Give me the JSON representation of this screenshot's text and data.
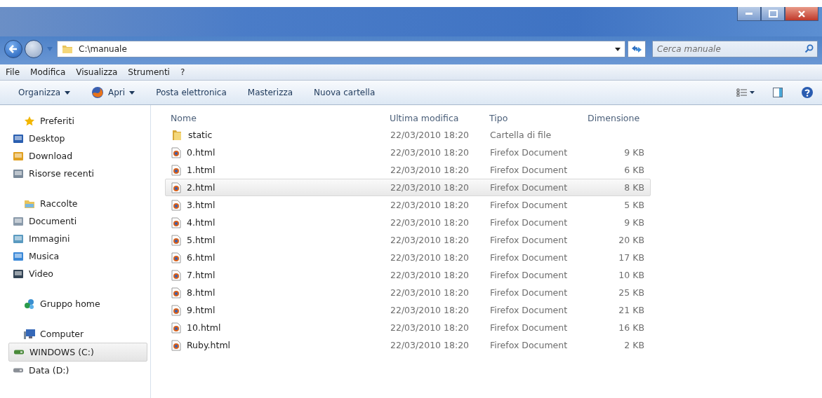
{
  "address": {
    "path": "C:\\manuale"
  },
  "search": {
    "placeholder": "Cerca manuale"
  },
  "menu": [
    "File",
    "Modifica",
    "Visualizza",
    "Strumenti",
    "?"
  ],
  "toolbar": [
    {
      "label": "Organizza",
      "dropdown": true
    },
    {
      "label": "Apri",
      "dropdown": true
    },
    {
      "label": "Posta elettronica",
      "dropdown": false
    },
    {
      "label": "Masterizza",
      "dropdown": false
    },
    {
      "label": "Nuova cartella",
      "dropdown": false
    }
  ],
  "sidebar": {
    "groups": [
      {
        "label": "Preferiti",
        "children": [
          {
            "label": "Desktop",
            "selected": false
          },
          {
            "label": "Download",
            "selected": false
          },
          {
            "label": "Risorse recenti",
            "selected": false
          }
        ]
      },
      {
        "label": "Raccolte",
        "children": [
          {
            "label": "Documenti",
            "selected": false
          },
          {
            "label": "Immagini",
            "selected": false
          },
          {
            "label": "Musica",
            "selected": false
          },
          {
            "label": "Video",
            "selected": false
          }
        ]
      },
      {
        "label": "Gruppo home"
      },
      {
        "label": "Computer",
        "children": [
          {
            "label": "WINDOWS (C:)",
            "selected": true
          },
          {
            "label": "Data (D:)",
            "selected": false
          }
        ]
      }
    ]
  },
  "table": {
    "columns": [
      "Nome",
      "Ultima modifica",
      "Tipo",
      "Dimensione"
    ],
    "rows": [
      {
        "kind": "folder",
        "name": "static",
        "modified": "22/03/2010 18:20",
        "type": "Cartella di file",
        "size": "",
        "selected": false
      },
      {
        "kind": "document",
        "name": "0.html",
        "modified": "22/03/2010 18:20",
        "type": "Firefox Document",
        "size": "9 KB",
        "selected": false
      },
      {
        "kind": "document",
        "name": "1.html",
        "modified": "22/03/2010 18:20",
        "type": "Firefox Document",
        "size": "6 KB",
        "selected": false
      },
      {
        "kind": "document",
        "name": "2.html",
        "modified": "22/03/2010 18:20",
        "type": "Firefox Document",
        "size": "8 KB",
        "selected": true
      },
      {
        "kind": "document",
        "name": "3.html",
        "modified": "22/03/2010 18:20",
        "type": "Firefox Document",
        "size": "5 KB",
        "selected": false
      },
      {
        "kind": "document",
        "name": "4.html",
        "modified": "22/03/2010 18:20",
        "type": "Firefox Document",
        "size": "9 KB",
        "selected": false
      },
      {
        "kind": "document",
        "name": "5.html",
        "modified": "22/03/2010 18:20",
        "type": "Firefox Document",
        "size": "20 KB",
        "selected": false
      },
      {
        "kind": "document",
        "name": "6.html",
        "modified": "22/03/2010 18:20",
        "type": "Firefox Document",
        "size": "17 KB",
        "selected": false
      },
      {
        "kind": "document",
        "name": "7.html",
        "modified": "22/03/2010 18:20",
        "type": "Firefox Document",
        "size": "10 KB",
        "selected": false
      },
      {
        "kind": "document",
        "name": "8.html",
        "modified": "22/03/2010 18:20",
        "type": "Firefox Document",
        "size": "25 KB",
        "selected": false
      },
      {
        "kind": "document",
        "name": "9.html",
        "modified": "22/03/2010 18:20",
        "type": "Firefox Document",
        "size": "21 KB",
        "selected": false
      },
      {
        "kind": "document",
        "name": "10.html",
        "modified": "22/03/2010 18:20",
        "type": "Firefox Document",
        "size": "16 KB",
        "selected": false
      },
      {
        "kind": "document",
        "name": "Ruby.html",
        "modified": "22/03/2010 18:20",
        "type": "Firefox Document",
        "size": "2 KB",
        "selected": false
      }
    ]
  }
}
